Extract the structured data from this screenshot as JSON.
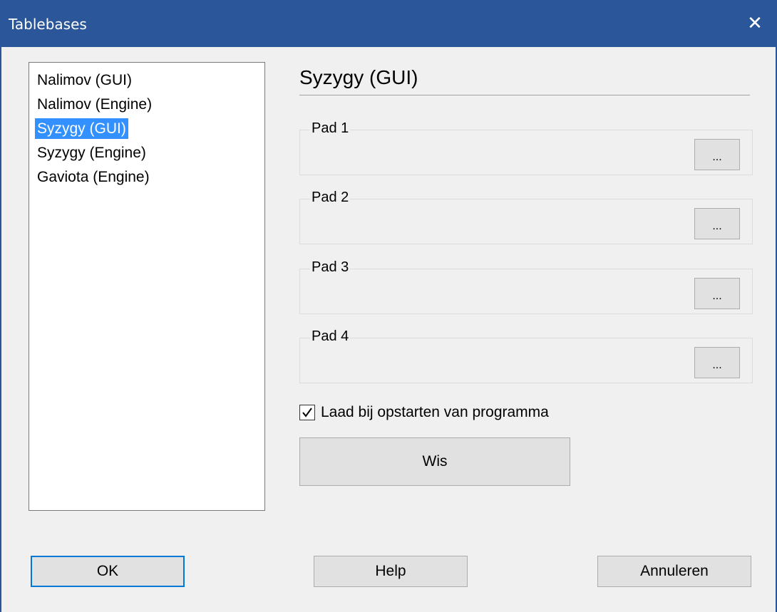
{
  "window": {
    "title": "Tablebases",
    "close_glyph": "✕"
  },
  "colors": {
    "titlebar": "#2b579a",
    "selection": "#3390ff",
    "default_button_border": "#0078d7"
  },
  "list": {
    "items": [
      {
        "label": "Nalimov (GUI)",
        "selected": false
      },
      {
        "label": "Nalimov (Engine)",
        "selected": false
      },
      {
        "label": "Syzygy (GUI)",
        "selected": true
      },
      {
        "label": "Syzygy (Engine)",
        "selected": false
      },
      {
        "label": "Gaviota (Engine)",
        "selected": false
      }
    ]
  },
  "panel": {
    "heading": "Syzygy (GUI)",
    "paths": [
      {
        "label": "Pad 1",
        "browse_label": "..."
      },
      {
        "label": "Pad 2",
        "browse_label": "..."
      },
      {
        "label": "Pad 3",
        "browse_label": "..."
      },
      {
        "label": "Pad 4",
        "browse_label": "..."
      }
    ],
    "load_on_startup": {
      "label": "Laad bij opstarten van programma",
      "checked": true
    },
    "clear_label": "Wis"
  },
  "footer": {
    "ok_label": "OK",
    "help_label": "Help",
    "cancel_label": "Annuleren"
  }
}
